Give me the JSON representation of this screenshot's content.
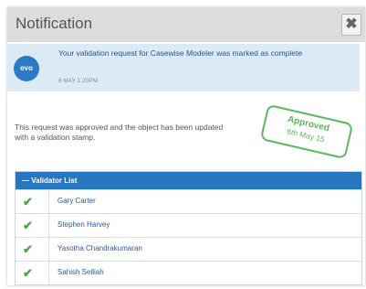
{
  "dialog": {
    "title": "Notification",
    "close_label": "✖"
  },
  "message": {
    "logo_text": "evo",
    "text": "Your validation request for Casewise Modeler was marked as complete",
    "time": "6 MAY 1:20PM"
  },
  "body": {
    "text": "This request was approved and the object has been updated with a validation stamp."
  },
  "stamp": {
    "line1": "Approved",
    "line2": "6th May 15",
    "color": "#5cb85c"
  },
  "validators": {
    "header": "— Validator List",
    "names": [
      "Gary Carter",
      "Stephen Harvey",
      "Yasotha Chandrakumaran",
      "Sahish Selliah"
    ]
  }
}
